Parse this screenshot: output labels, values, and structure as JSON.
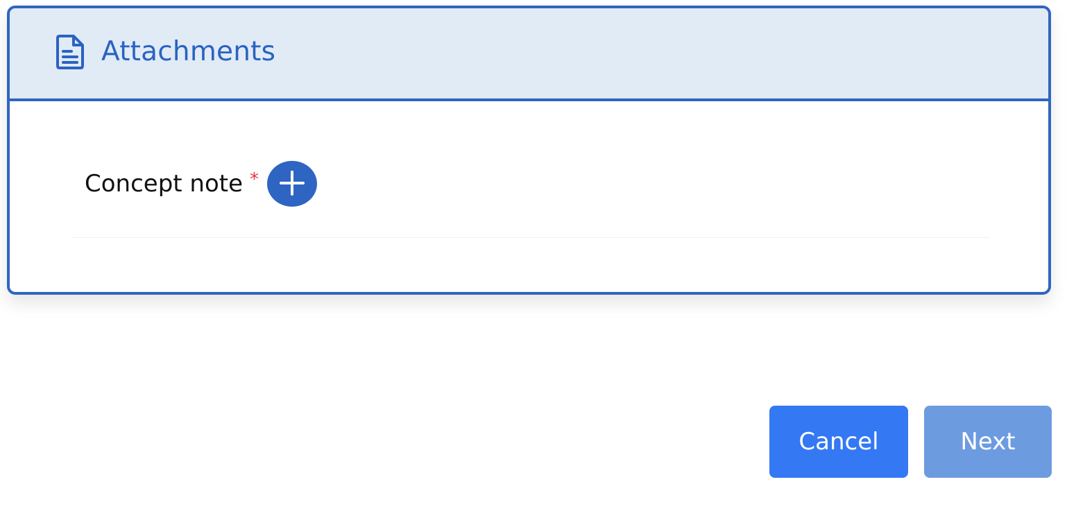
{
  "card": {
    "title": "Attachments",
    "title_icon": "document-icon"
  },
  "fields": [
    {
      "label": "Concept note",
      "required_marker": "*",
      "action_icon": "plus-icon"
    }
  ],
  "footer": {
    "cancel_label": "Cancel",
    "next_label": "Next"
  },
  "colors": {
    "accent": "#2f65c2",
    "header_bg": "#e1ebf6",
    "cancel_bg": "#3478f3",
    "next_bg_disabled": "#6d9be0",
    "required": "#e03a4a"
  }
}
